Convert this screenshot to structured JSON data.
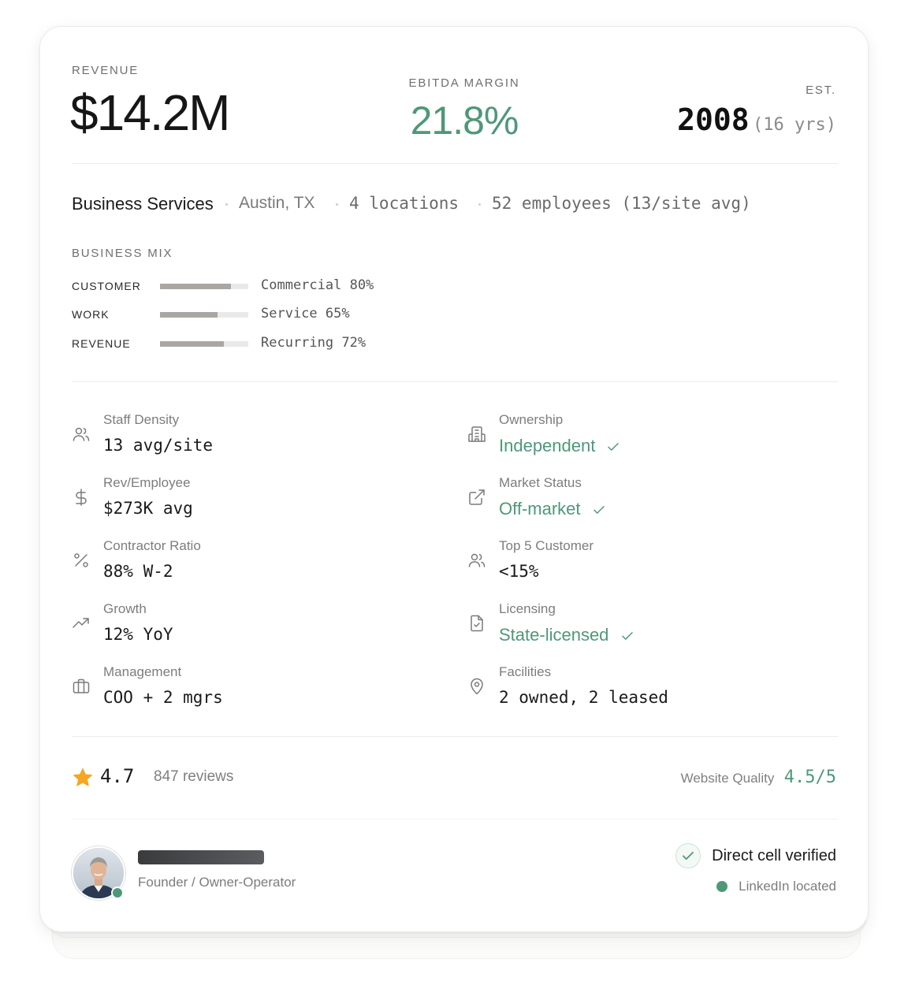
{
  "metrics": {
    "revenue_label": "REVENUE",
    "revenue_value": "$14.2M",
    "ebitda_label": "EBITDA MARGIN",
    "ebitda_value": "21.8%",
    "est_label": "EST.",
    "est_year": "2008",
    "est_years": "(16 yrs)"
  },
  "meta": {
    "industry": "Business Services",
    "location": "Austin, TX",
    "locations": "4 locations",
    "employees": "52 employees (13/site avg)"
  },
  "mix": {
    "title": "BUSINESS MIX",
    "rows": [
      {
        "label": "CUSTOMER",
        "value_text": "Commercial 80%",
        "fraction": 0.8
      },
      {
        "label": "WORK",
        "value_text": "Service 65%",
        "fraction": 0.65
      },
      {
        "label": "REVENUE",
        "value_text": "Recurring 72%",
        "fraction": 0.72
      }
    ]
  },
  "attributes": {
    "left": [
      {
        "icon": "users-icon",
        "label": "Staff Density",
        "value": "13 avg/site"
      },
      {
        "icon": "dollar-icon",
        "label": "Rev/Employee",
        "value": "$273K avg"
      },
      {
        "icon": "percent-icon",
        "label": "Contractor Ratio",
        "value": "88% W-2"
      },
      {
        "icon": "trending-up-icon",
        "label": "Growth",
        "value": "12% YoY"
      },
      {
        "icon": "briefcase-icon",
        "label": "Management",
        "value": "COO + 2 mgrs"
      }
    ],
    "right": [
      {
        "icon": "building-icon",
        "label": "Ownership",
        "value": "Independent",
        "verified": true
      },
      {
        "icon": "external-link-icon",
        "label": "Market Status",
        "value": "Off-market",
        "verified": true
      },
      {
        "icon": "users-icon",
        "label": "Top 5 Customer",
        "value": "<15%",
        "verified": false
      },
      {
        "icon": "file-check-icon",
        "label": "Licensing",
        "value": "State-licensed",
        "verified": true
      },
      {
        "icon": "map-pin-icon",
        "label": "Facilities",
        "value": "2 owned, 2 leased",
        "verified": false
      }
    ]
  },
  "rating": {
    "icon": "star-icon",
    "value": "4.7",
    "reviews": "847 reviews",
    "website_quality_label": "Website Quality",
    "website_quality_value": "4.5/5"
  },
  "founder": {
    "role": "Founder / Owner-Operator",
    "verified_label": "Direct cell verified",
    "linkedin_label": "LinkedIn located"
  },
  "colors": {
    "accent_green": "#4e9878",
    "star": "#f5a623",
    "bar_fill": "#aaa6a2"
  }
}
